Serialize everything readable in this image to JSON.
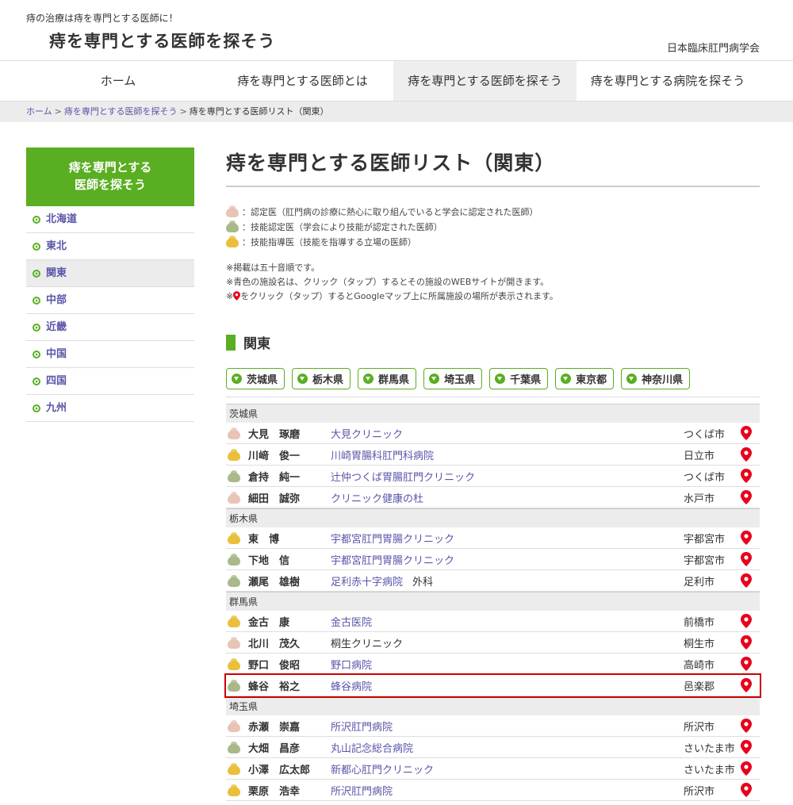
{
  "header": {
    "tagline": "痔の治療は痔を専門とする医師に！",
    "title": "痔を専門とする医師を探そう",
    "society": "日本臨床肛門病学会"
  },
  "nav": [
    {
      "label": "ホーム"
    },
    {
      "label": "痔を専門とする医師とは"
    },
    {
      "label": "痔を専門とする医師を探そう",
      "active": true
    },
    {
      "label": "痔を専門とする病院を探そう"
    }
  ],
  "breadcrumb": {
    "home": "ホーム",
    "sep": ">",
    "search": "痔を専門とする医師を探そう",
    "current": "痔を専門とする医師リスト（関東）"
  },
  "sidebar": {
    "heading_line1": "痔を専門とする",
    "heading_line2": "医師を探そう",
    "items": [
      {
        "label": "北海道"
      },
      {
        "label": "東北"
      },
      {
        "label": "関東",
        "active": true
      },
      {
        "label": "中部"
      },
      {
        "label": "近畿"
      },
      {
        "label": "中国"
      },
      {
        "label": "四国"
      },
      {
        "label": "九州"
      }
    ]
  },
  "main": {
    "title": "痔を専門とする医師リスト（関東）",
    "legend": [
      {
        "color": "pink",
        "text": "：認定医（肛門病の診療に熱心に取り組んでいると学会に認定された医師）"
      },
      {
        "color": "green",
        "text": "：技能認定医（学会により技能が認定された医師）"
      },
      {
        "color": "yellow",
        "text": "：技能指導医（技能を指導する立場の医師）"
      }
    ],
    "note1": "※掲載は五十音順です。",
    "note2": "※青色の施設名は、クリック（タップ）するとその施設のWEBサイトが開きます。",
    "note3_prefix": "※",
    "note3_suffix": "をクリック（タップ）するとGoogleマップ上に所属施設の場所が表示されます。",
    "region": "関東",
    "pref_buttons": [
      "茨城県",
      "栃木県",
      "群馬県",
      "埼玉県",
      "千葉県",
      "東京都",
      "神奈川県"
    ]
  },
  "groups": [
    {
      "pref": "茨城県",
      "doctors": [
        {
          "name": "大見　琢磨",
          "level": "pink",
          "clinic": "大見クリニック",
          "linked": true,
          "city": "つくば市"
        },
        {
          "name": "川﨑　俊一",
          "level": "yellow",
          "clinic": "川崎胃腸科肛門科病院",
          "linked": true,
          "city": "日立市"
        },
        {
          "name": "倉持　純一",
          "level": "green",
          "clinic": "辻仲つくば胃腸肛門クリニック",
          "linked": true,
          "city": "つくば市"
        },
        {
          "name": "細田　誠弥",
          "level": "pink",
          "clinic": "クリニック健康の杜",
          "linked": true,
          "city": "水戸市"
        }
      ]
    },
    {
      "pref": "栃木県",
      "doctors": [
        {
          "name": "東　博",
          "level": "yellow",
          "clinic": "宇都宮肛門胃腸クリニック",
          "linked": true,
          "city": "宇都宮市"
        },
        {
          "name": "下地　信",
          "level": "green",
          "clinic": "宇都宮肛門胃腸クリニック",
          "linked": true,
          "city": "宇都宮市"
        },
        {
          "name": "瀬尾　雄樹",
          "level": "green",
          "clinic": "足利赤十字病院",
          "dept": "外科",
          "linked": true,
          "city": "足利市"
        }
      ]
    },
    {
      "pref": "群馬県",
      "doctors": [
        {
          "name": "金古　康",
          "level": "yellow",
          "clinic": "金古医院",
          "linked": true,
          "city": "前橋市"
        },
        {
          "name": "北川　茂久",
          "level": "pink",
          "clinic": "桐生クリニック",
          "linked": false,
          "city": "桐生市"
        },
        {
          "name": "野口　俊昭",
          "level": "yellow",
          "clinic": "野口病院",
          "linked": true,
          "city": "高崎市"
        },
        {
          "name": "蜂谷　裕之",
          "level": "green",
          "clinic": "蜂谷病院",
          "linked": true,
          "city": "邑楽郡",
          "highlight": true
        }
      ]
    },
    {
      "pref": "埼玉県",
      "doctors": [
        {
          "name": "赤瀬　崇嘉",
          "level": "pink",
          "clinic": "所沢肛門病院",
          "linked": true,
          "city": "所沢市"
        },
        {
          "name": "大畑　昌彦",
          "level": "green",
          "clinic": "丸山記念総合病院",
          "linked": true,
          "city": "さいたま市"
        },
        {
          "name": "小澤　広太郎",
          "level": "yellow",
          "clinic": "新都心肛門クリニック",
          "linked": true,
          "city": "さいたま市"
        },
        {
          "name": "栗原　浩幸",
          "level": "yellow",
          "clinic": "所沢肛門病院",
          "linked": true,
          "city": "所沢市"
        }
      ]
    }
  ],
  "colors": {
    "accent": "#5aae22",
    "link": "#5a55a8",
    "pin": "#e8001c",
    "highlight": "#cc0000"
  }
}
